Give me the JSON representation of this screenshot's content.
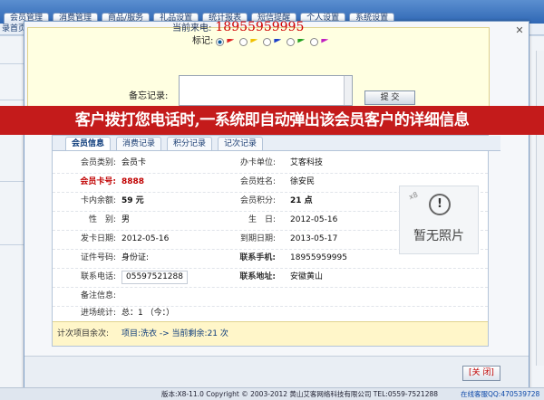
{
  "nav": {
    "tabs": [
      "会员管理",
      "消费管理",
      "商品/服务",
      "礼品设置",
      "统计报表",
      "短信提醒",
      "个人设置",
      "系统设置"
    ],
    "breadcrumb": "录首页"
  },
  "call": {
    "label": "当前来电:",
    "number": "18955959995",
    "mark_label": "标记:",
    "flags": [
      {
        "color": "#e02020",
        "selected": true
      },
      {
        "color": "#f0c000",
        "selected": false
      },
      {
        "color": "#1a3ec8",
        "selected": false
      },
      {
        "color": "#22a020",
        "selected": false
      },
      {
        "color": "#c020c0",
        "selected": false
      }
    ],
    "memo_label": "备忘记录:",
    "memo_value": "",
    "submit_label": "提 交"
  },
  "banner": "客户拨打您电话时,一系统即自动弹出该会员客户的详细信息",
  "tabs": [
    "会员信息",
    "消费记录",
    "积分记录",
    "记次记录"
  ],
  "member": {
    "type_label": "会员类别:",
    "type": "会员卡",
    "unit_label": "办卡单位:",
    "unit": "艾客科技",
    "card_label": "会员卡号:",
    "card": "8888",
    "name_label": "会员姓名:",
    "name": "徐安民",
    "balance_label": "卡内余额:",
    "balance": "59 元",
    "points_label": "会员积分:",
    "points": "21 点",
    "gender_label": "性　别:",
    "gender": "男",
    "birthday_label": "生　日:",
    "birthday": "2012-05-16",
    "issue_label": "发卡日期:",
    "issue": "2012-05-16",
    "expire_label": "到期日期:",
    "expire": "2013-05-17",
    "id_label": "证件号码:",
    "id": "身份证:",
    "mobile_label": "联系手机:",
    "mobile": "18955959995",
    "phone_label": "联系电话:",
    "phone": "05597521288",
    "address_label": "联系地址:",
    "address": "安徽黄山",
    "note_label": "备注信息:",
    "note": "",
    "progress_label": "进场统计:",
    "progress": "总：1 （今：）",
    "count_label": "计次项目余次:",
    "count": "项目:洗衣 -> 当前剩余:21 次"
  },
  "photo": {
    "text": "暂无照片",
    "badge": "x8"
  },
  "close_label": "[关 闭]",
  "footer": {
    "text": "版本:X8-11.0 Copyright © 2003-2012 黄山艾客网络科技有限公司 TEL:0559-7521288",
    "qq": "在线客服QQ:470539728"
  }
}
